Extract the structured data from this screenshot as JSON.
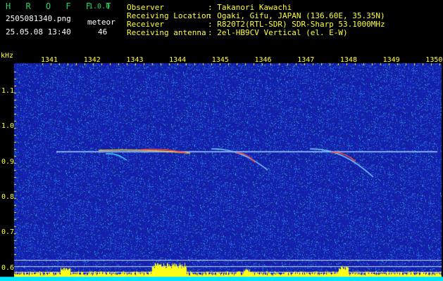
{
  "header": {
    "app_name": "H R O F F T",
    "version": "1.0.0",
    "filename": "2505081340.png",
    "datetime": "25.05.08 13:40",
    "meteor_label": "meteor",
    "meteor_count": "46",
    "info": [
      {
        "key": "Observer",
        "value": ": Takanori Kawachi"
      },
      {
        "key": "Receiving Location",
        "value": ": Ogaki, Gifu, JAPAN (136.60E, 35.35N)"
      },
      {
        "key": "Receiver",
        "value": ": R820T2(RTL-SDR) SDR-Sharp 53.1000MHz"
      },
      {
        "key": "Receiving antenna",
        "value": ": 2el-HB9CV Vertical (el. E-W)"
      }
    ]
  },
  "spectrogram": {
    "unit_label": "kHz",
    "time_ticks": [
      "1341",
      "1342",
      "1343",
      "1344",
      "1345",
      "1346",
      "1347",
      "1348",
      "1349",
      "1350"
    ],
    "freq_ticks": [
      "1.1",
      "1.0",
      "0.9",
      "0.8",
      "0.7",
      "0.6"
    ],
    "colors": {
      "background": "#1a2a9a",
      "carrier": "#9fd4ff",
      "meteor": "#ff4a3a",
      "level_bar": "#ffff1a",
      "baseline": "#00e5ff"
    }
  }
}
